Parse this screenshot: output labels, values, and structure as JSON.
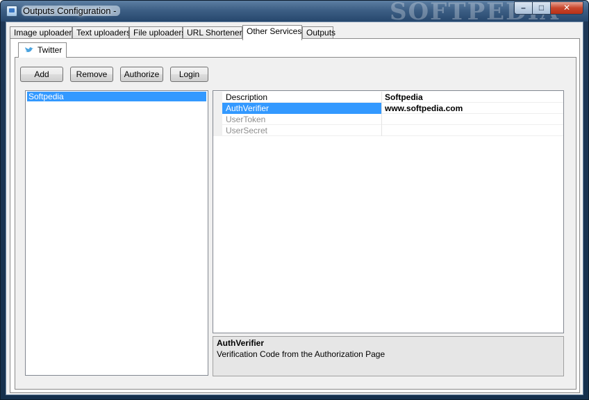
{
  "window": {
    "title": "Outputs Configuration -",
    "watermark": "SOFTPEDIA",
    "controls": {
      "minimize": "–",
      "maximize": "□",
      "close": "✕"
    }
  },
  "tabs": [
    {
      "label": "Image uploaders"
    },
    {
      "label": "Text uploaders"
    },
    {
      "label": "File uploaders"
    },
    {
      "label": "URL Shorteners"
    },
    {
      "label": "Other Services",
      "active": true
    },
    {
      "label": "Outputs"
    }
  ],
  "inner_tab": {
    "label": "Twitter",
    "icon": "twitter-bird-icon"
  },
  "buttons": {
    "add": "Add",
    "remove": "Remove",
    "authorize": "Authorize",
    "login": "Login"
  },
  "accounts": [
    {
      "label": "Softpedia",
      "selected": true
    }
  ],
  "properties": [
    {
      "name": "Description",
      "value": "Softpedia"
    },
    {
      "name": "AuthVerifier",
      "value": "www.softpedia.com",
      "selected": true
    },
    {
      "name": "UserToken",
      "value": "",
      "disabled": true
    },
    {
      "name": "UserSecret",
      "value": "",
      "disabled": true
    }
  ],
  "help": {
    "title": "AuthVerifier",
    "description": "Verification Code from the Authorization Page"
  },
  "colors": {
    "selection": "#3399ff",
    "accent_titlebar": "#3d5f85",
    "close_button": "#c8462c"
  }
}
